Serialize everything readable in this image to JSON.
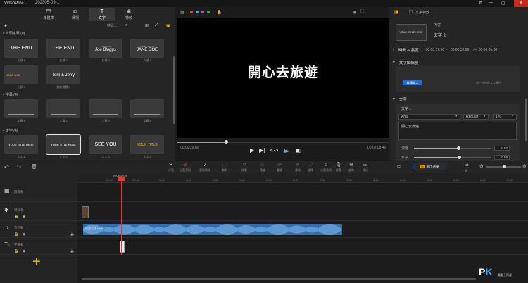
{
  "titlebar": {
    "app_name": "VideoProc ⌄",
    "project_name": "202305-09-1",
    "ctrl_settings": "⚙",
    "ctrl_min": "—",
    "ctrl_max": "▢",
    "ctrl_close": "✕"
  },
  "library": {
    "tabs": [
      {
        "label": "媒體庫",
        "icon": "🎞"
      },
      {
        "label": "轉場",
        "icon": "⧉"
      },
      {
        "label": "文字",
        "icon": "T"
      },
      {
        "label": "特效",
        "icon": "✱"
      }
    ],
    "search_placeholder": "搜尋...",
    "sections": [
      {
        "title": "片頭字幕 (8)"
      },
      {
        "title": "字幕 (4)"
      },
      {
        "title": "文字 (4)"
      }
    ],
    "row1": [
      {
        "text": "THE END",
        "label": "片頭 1"
      },
      {
        "text": "THE END",
        "label": "片頭 2"
      },
      {
        "text": "Joe Bloggs",
        "label": "片頭 3",
        "pre": "STARRING"
      },
      {
        "text": "JANE DOE",
        "label": "片頭 4",
        "pre": "DIRECTED BY"
      }
    ],
    "row2": [
      {
        "text": "JANE DOE",
        "label": "片頭 5"
      },
      {
        "text": "Tom & Jerry",
        "label": "我的標題 6"
      }
    ],
    "row3": [
      {
        "label": "字幕 1"
      },
      {
        "label": "字幕 2"
      },
      {
        "label": "字幕 3"
      },
      {
        "label": "字幕 4"
      }
    ],
    "row4": [
      {
        "text": "YOUR TITLE HERE",
        "label": "文字 1"
      },
      {
        "text": "YOUR TITLE HERE",
        "label": "文字 2"
      },
      {
        "text": "SEE YOU",
        "label": "文字 3"
      },
      {
        "text": "YOUR TITLE",
        "label": "文字 4"
      }
    ]
  },
  "preview": {
    "caption": "開心去旅遊",
    "time_current": "00:00:29.60",
    "time_total": "00:02:08.40",
    "progress": 0.23
  },
  "properties": {
    "tab_label": "文字特效",
    "thumb_text": "YOUR TITLE HERE",
    "section_content": "內容",
    "content_name": "文字 2",
    "time_label": "時間 & 長度",
    "time_start": "00:00:27.96",
    "time_end": "00:00:32.96",
    "duration": "00:00:05.00",
    "editor_label": "文字編輯器",
    "edit_button": "編輯文字",
    "edit_hint": "進一步修改文字屬性",
    "text_label": "文字",
    "text_item": "文字 1",
    "font": "Arial",
    "style": "Regular",
    "size": "170",
    "text_value": "開心去旅遊",
    "opacity_label": "濃度",
    "opacity_value": "0.57",
    "opacity": 0.57,
    "horizontal_label": "水平",
    "horizontal_value": "0.58",
    "horizontal": 0.58
  },
  "timeline_toolbar": {
    "undo": "↶",
    "redo": "↷",
    "delete": "🗑",
    "items": [
      {
        "label": "分割",
        "icon": "✂"
      },
      {
        "label": "分割音訊",
        "icon": "⊘",
        "red": true
      },
      {
        "label": "音訊偵測",
        "icon": "♪"
      },
      {
        "label": "裁剪",
        "icon": "⬚",
        "dim": true
      },
      {
        "label": "移動",
        "icon": "↺",
        "dim": true
      },
      {
        "label": "速度",
        "icon": "⏱",
        "dim": true
      },
      {
        "label": "重複",
        "icon": "⟳",
        "dim": true
      },
      {
        "label": "凍結",
        "icon": "❄",
        "dim": true
      },
      {
        "label": "旋轉",
        "icon": "⤾",
        "dim": true
      },
      {
        "label": "分離音訊",
        "icon": "♫"
      },
      {
        "label": "錄音",
        "icon": "🎙"
      },
      {
        "label": "變焦",
        "icon": "⊕"
      },
      {
        "label": "標記",
        "icon": "▭"
      }
    ],
    "fx_badge": "FX",
    "fx_label": "輸出選單",
    "tool_label": "工具"
  },
  "timeline": {
    "ruler_time": "00:00:29.60",
    "ticks": [
      "00:00",
      "00:10",
      "0:20",
      "1:00",
      "1:20",
      "1:40",
      "2:00",
      "2:20",
      "2:40",
      "3:00",
      "3:20",
      "3:40",
      "4:00",
      "4:20",
      "4:40",
      "5:00"
    ],
    "tracks": [
      {
        "name": "圖像軌",
        "icon": "▦"
      },
      {
        "name": "特效軌",
        "icon": "✱"
      },
      {
        "name": "音訊軌",
        "icon": "♫"
      },
      {
        "name": "字幕軌",
        "icon": "T↕"
      }
    ],
    "audio_clip_label": "旅遊音訊.mp3"
  },
  "watermark": {
    "p": "P",
    "k": "K",
    "sub": "電腦王阿達"
  }
}
